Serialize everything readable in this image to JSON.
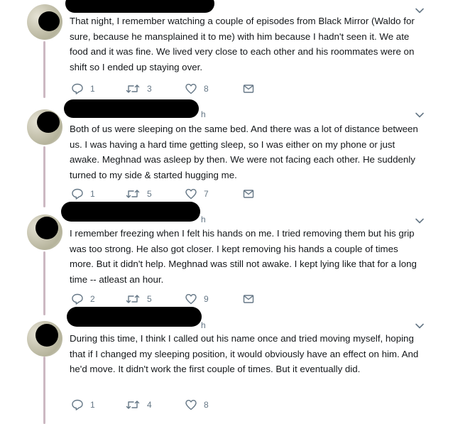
{
  "tweets": [
    {
      "header_fragment": "",
      "text": "That night, I remember watching a couple of episodes from Black Mirror (Waldo for sure, because he mansplained it to me) with him because I hadn't seen it. We ate food and it was fine. We lived very close to each other and his roommates were on shift so I ended up staying over.",
      "replies": "1",
      "retweets": "3",
      "likes": "8"
    },
    {
      "header_fragment": "h",
      "text": "Both of us were sleeping on the same bed. And there was a lot of distance between us. I was having a hard time getting sleep, so I was either on my phone or just awake. Meghnad was asleep by then. We were not facing each other. He suddenly turned to my side & started hugging me.",
      "replies": "1",
      "retweets": "5",
      "likes": "7"
    },
    {
      "header_fragment": "h",
      "text": "I remember freezing when I felt his hands on me. I tried removing them but his grip was too strong. He also got closer. I kept removing his hands a couple of times more. But it didn't help. Meghnad was still not awake. I kept lying like that for a long time -- atleast an hour.",
      "replies": "2",
      "retweets": "5",
      "likes": "9"
    },
    {
      "header_fragment": "h",
      "text": "During this time, I think I called out his name once and tried moving myself, hoping that if I changed my sleeping position, it would obviously have an effect on him. And he'd move. It didn't work the first couple of times. But it eventually did.",
      "replies": "1",
      "retweets": "4",
      "likes": "8"
    }
  ],
  "icons": {
    "reply": "reply-icon",
    "retweet": "retweet-icon",
    "like": "heart-icon",
    "message": "envelope-icon",
    "more": "chevron-down-icon"
  },
  "colors": {
    "thread_line": "#ccb8c2",
    "icon_gray": "#657786",
    "text": "#14171a"
  }
}
